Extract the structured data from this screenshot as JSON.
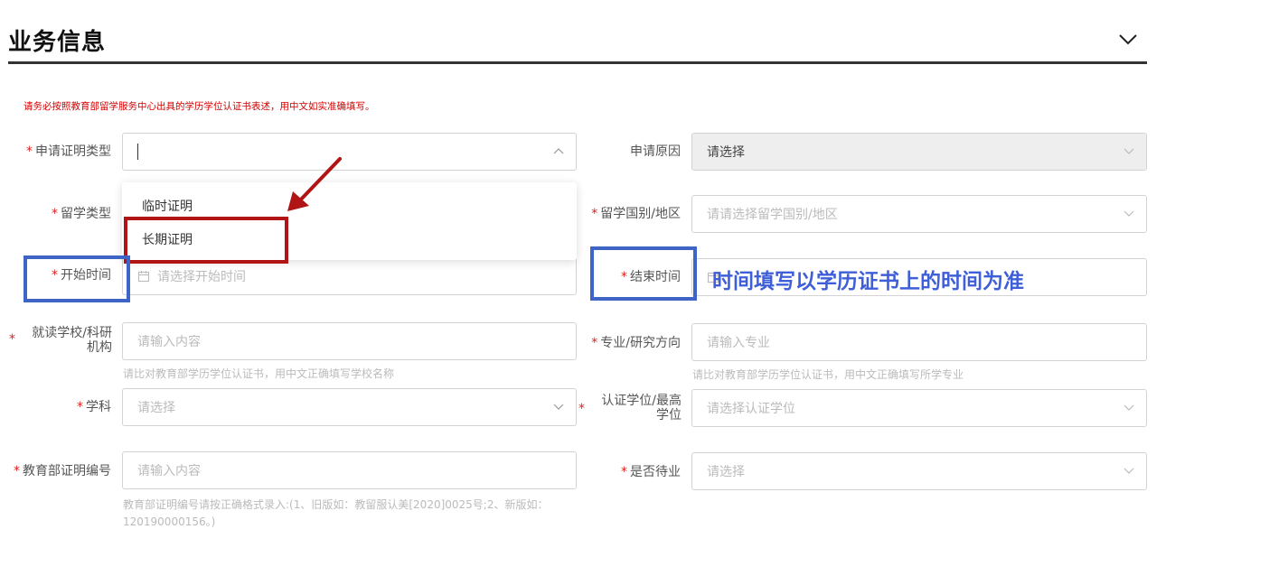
{
  "section": {
    "title": "业务信息"
  },
  "notice": "请务必按照教育部留学服务中心出具的学历学位认证书表述，用中文如实准确填写。",
  "form": {
    "cert_type": {
      "label": "申请证明类型",
      "value": ""
    },
    "cert_type_options": [
      "临时证明",
      "长期证明"
    ],
    "apply_reason": {
      "label": "申请原因",
      "value": "请选择"
    },
    "study_type": {
      "label": "留学类型"
    },
    "study_country": {
      "label": "留学国别/地区",
      "placeholder": "请请选择留学国别/地区"
    },
    "start_time": {
      "label": "开始时间",
      "placeholder": "请选择开始时间"
    },
    "end_time": {
      "label": "结束时间"
    },
    "school": {
      "label": "就读学校/科研机构",
      "placeholder": "请输入内容",
      "hint": "请比对教育部学历学位认证书，用中文正确填写学校名称"
    },
    "major": {
      "label": "专业/研究方向",
      "placeholder": "请输入专业",
      "hint": "请比对教育部学历学位认证书，用中文正确填写所学专业"
    },
    "subject": {
      "label": "学科",
      "placeholder": "请选择"
    },
    "degree": {
      "label": "认证学位/最高学位",
      "placeholder": "请选择认证学位"
    },
    "moe_cert_no": {
      "label": "教育部证明编号",
      "placeholder": "请输入内容",
      "hint": "教育部证明编号请按正确格式录入:(1、旧版如：教留服认美[2020]0025号;2、新版如：120190000156。)"
    },
    "unemployed": {
      "label": "是否待业",
      "placeholder": "请选择"
    }
  },
  "annotation": {
    "text": "时间填写以学历证书上的时间为准"
  },
  "colors": {
    "required": "#e02020",
    "notice": "#d40000",
    "annotation_red": "#b01414",
    "annotation_blue": "#3f64c8"
  },
  "icons": [
    "chevron-down-icon",
    "chevron-up-icon",
    "calendar-icon",
    "arrow-annotation"
  ]
}
